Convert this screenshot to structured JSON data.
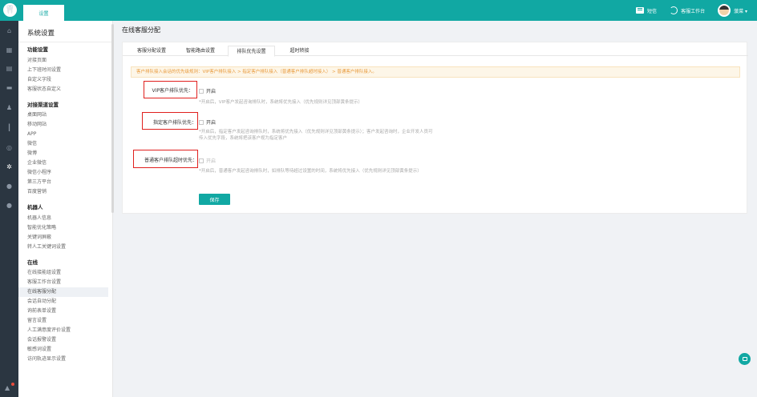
{
  "topbar": {
    "logo_glyph": "🦷",
    "tab_label": "设置",
    "sms_label": "短信",
    "workbench_label": "客服工作台",
    "user_label": "菠菜 ▾"
  },
  "rail_icons": [
    "home-icon",
    "grid-icon",
    "document-icon",
    "chat-icon",
    "users-icon",
    "chart-icon",
    "search-icon",
    "gear-icon",
    "globe-icon",
    "info-icon"
  ],
  "sidebar": {
    "title": "系统设置",
    "groups": [
      {
        "label": "功能设置",
        "items": [
          "对接页面",
          "上下班时间设置",
          "自定义字段",
          "客服状态自定义"
        ]
      },
      {
        "label": "对接渠道设置",
        "items": [
          "桌面网站",
          "移动网站",
          "APP",
          "微信",
          "微博",
          "企业微信",
          "微信小程序",
          "第三方平台",
          "百度营销"
        ]
      },
      {
        "label": "机器人",
        "items": [
          "机器人信息",
          "智能优化策略",
          "关键词屏蔽",
          "转人工关键词设置"
        ]
      },
      {
        "label": "在线",
        "items": [
          "在线接能组设置",
          "客服工作台设置",
          "在线客服分配",
          "会话自动分配",
          "询前表单设置",
          "留言设置",
          "人工满意度评价设置",
          "会话报警设置",
          "敏感词设置",
          "访问轨迹显示设置"
        ]
      }
    ],
    "active_item": "在线客服分配"
  },
  "main": {
    "page_title": "在线客服分配",
    "tabs": [
      "客服分配设置",
      "智能路由设置",
      "排队优先设置",
      "超时转接"
    ],
    "active_tab": "排队优先设置",
    "notice": "客户排队接入会话的优先级规则：VIP客户排队接入 > 指定客户排队接入（普通客户排队超时接入） > 普通客户排队接入。",
    "fields": [
      {
        "label": "VIP客户排队优先：",
        "option": "开启",
        "hint": "*开启后，VIP客户发起咨询排队时，系统将优先接入（优先规则详见顶部黄条提示）"
      },
      {
        "label": "指定客户排队优先：",
        "option": "开启",
        "hint": "*开启后，指定客户发起咨询排队时，系统将优先接入（优先规则详见顶部黄条提示）；客户发起咨询时，企业开发人员可传入优先字段，系统将把该客户视为指定客户"
      },
      {
        "label": "普通客户排队超时优先：",
        "option": "开启",
        "hint": "*开启后，普通客户发起咨询排队时，如排队等待超过设置的时间，系统将优先接入（优先规则详见顶部黄条提示）"
      }
    ],
    "save_label": "保存"
  },
  "colors": {
    "brand": "#11a8a3",
    "notice_text": "#e89a3c",
    "highlight": "#e0201e"
  }
}
